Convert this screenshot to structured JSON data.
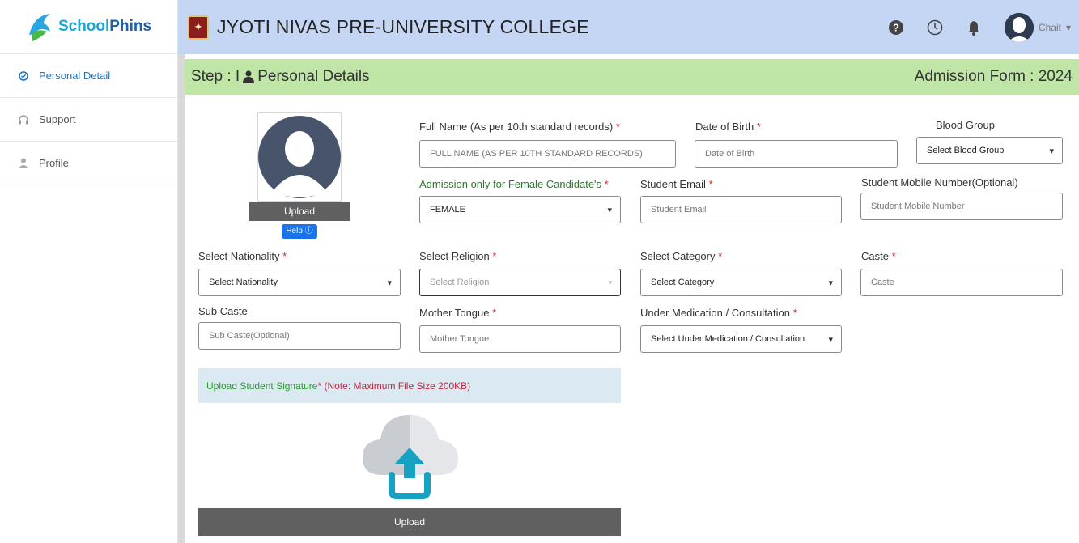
{
  "brand": {
    "school": "School",
    "phins": "Phins"
  },
  "sidebar": {
    "items": [
      {
        "label": "Personal Detail",
        "icon": "check-circle-icon",
        "active": true
      },
      {
        "label": "Support",
        "icon": "headset-icon",
        "active": false
      },
      {
        "label": "Profile",
        "icon": "user-icon",
        "active": false
      }
    ]
  },
  "header": {
    "college": "JYOTI NIVAS PRE-UNIVERSITY COLLEGE",
    "user_name": "Chait",
    "user_caret": "▾"
  },
  "stepbar": {
    "step": "Step : I",
    "title": "Personal Details",
    "form_title": "Admission Form : 2024"
  },
  "photo": {
    "upload_label": "Upload",
    "help_label": "Help ⓘ"
  },
  "fields": {
    "full_name": {
      "label": "Full Name (As per 10th standard records)",
      "placeholder": "FULL NAME (AS PER 10TH STANDARD RECORDS)"
    },
    "dob": {
      "label": "Date of Birth",
      "placeholder": "Date of Birth"
    },
    "blood_group": {
      "label": "Blood Group",
      "value": "Select Blood Group"
    },
    "gender": {
      "label": "Admission only for Female Candidate's",
      "value": "FEMALE"
    },
    "email": {
      "label": "Student Email",
      "placeholder": "Student Email"
    },
    "mobile": {
      "label": "Student Mobile Number(Optional)",
      "placeholder": "Student Mobile Number"
    },
    "nationality": {
      "label": "Select Nationality",
      "value": "Select Nationality"
    },
    "religion": {
      "label": "Select Religion",
      "value": "Select Religion"
    },
    "category": {
      "label": "Select Category",
      "value": "Select Category"
    },
    "caste": {
      "label": "Caste",
      "placeholder": "Caste"
    },
    "sub_caste": {
      "label": "Sub Caste",
      "placeholder": "Sub Caste(Optional)"
    },
    "mother_tongue": {
      "label": "Mother Tongue",
      "placeholder": "Mother Tongue"
    },
    "medication": {
      "label": "Under Medication / Consultation",
      "value": "Select Under Medication / Consultation"
    }
  },
  "required_mark": "*",
  "signature": {
    "title": "Upload Student Signature",
    "note": "(Note: Maximum File Size 200KB)",
    "upload_label": "Upload"
  },
  "colors": {
    "accent": "#1a73c9",
    "header_bg": "#c5d6f4",
    "step_bg": "#bfe6a6",
    "required": "#d9262c"
  }
}
